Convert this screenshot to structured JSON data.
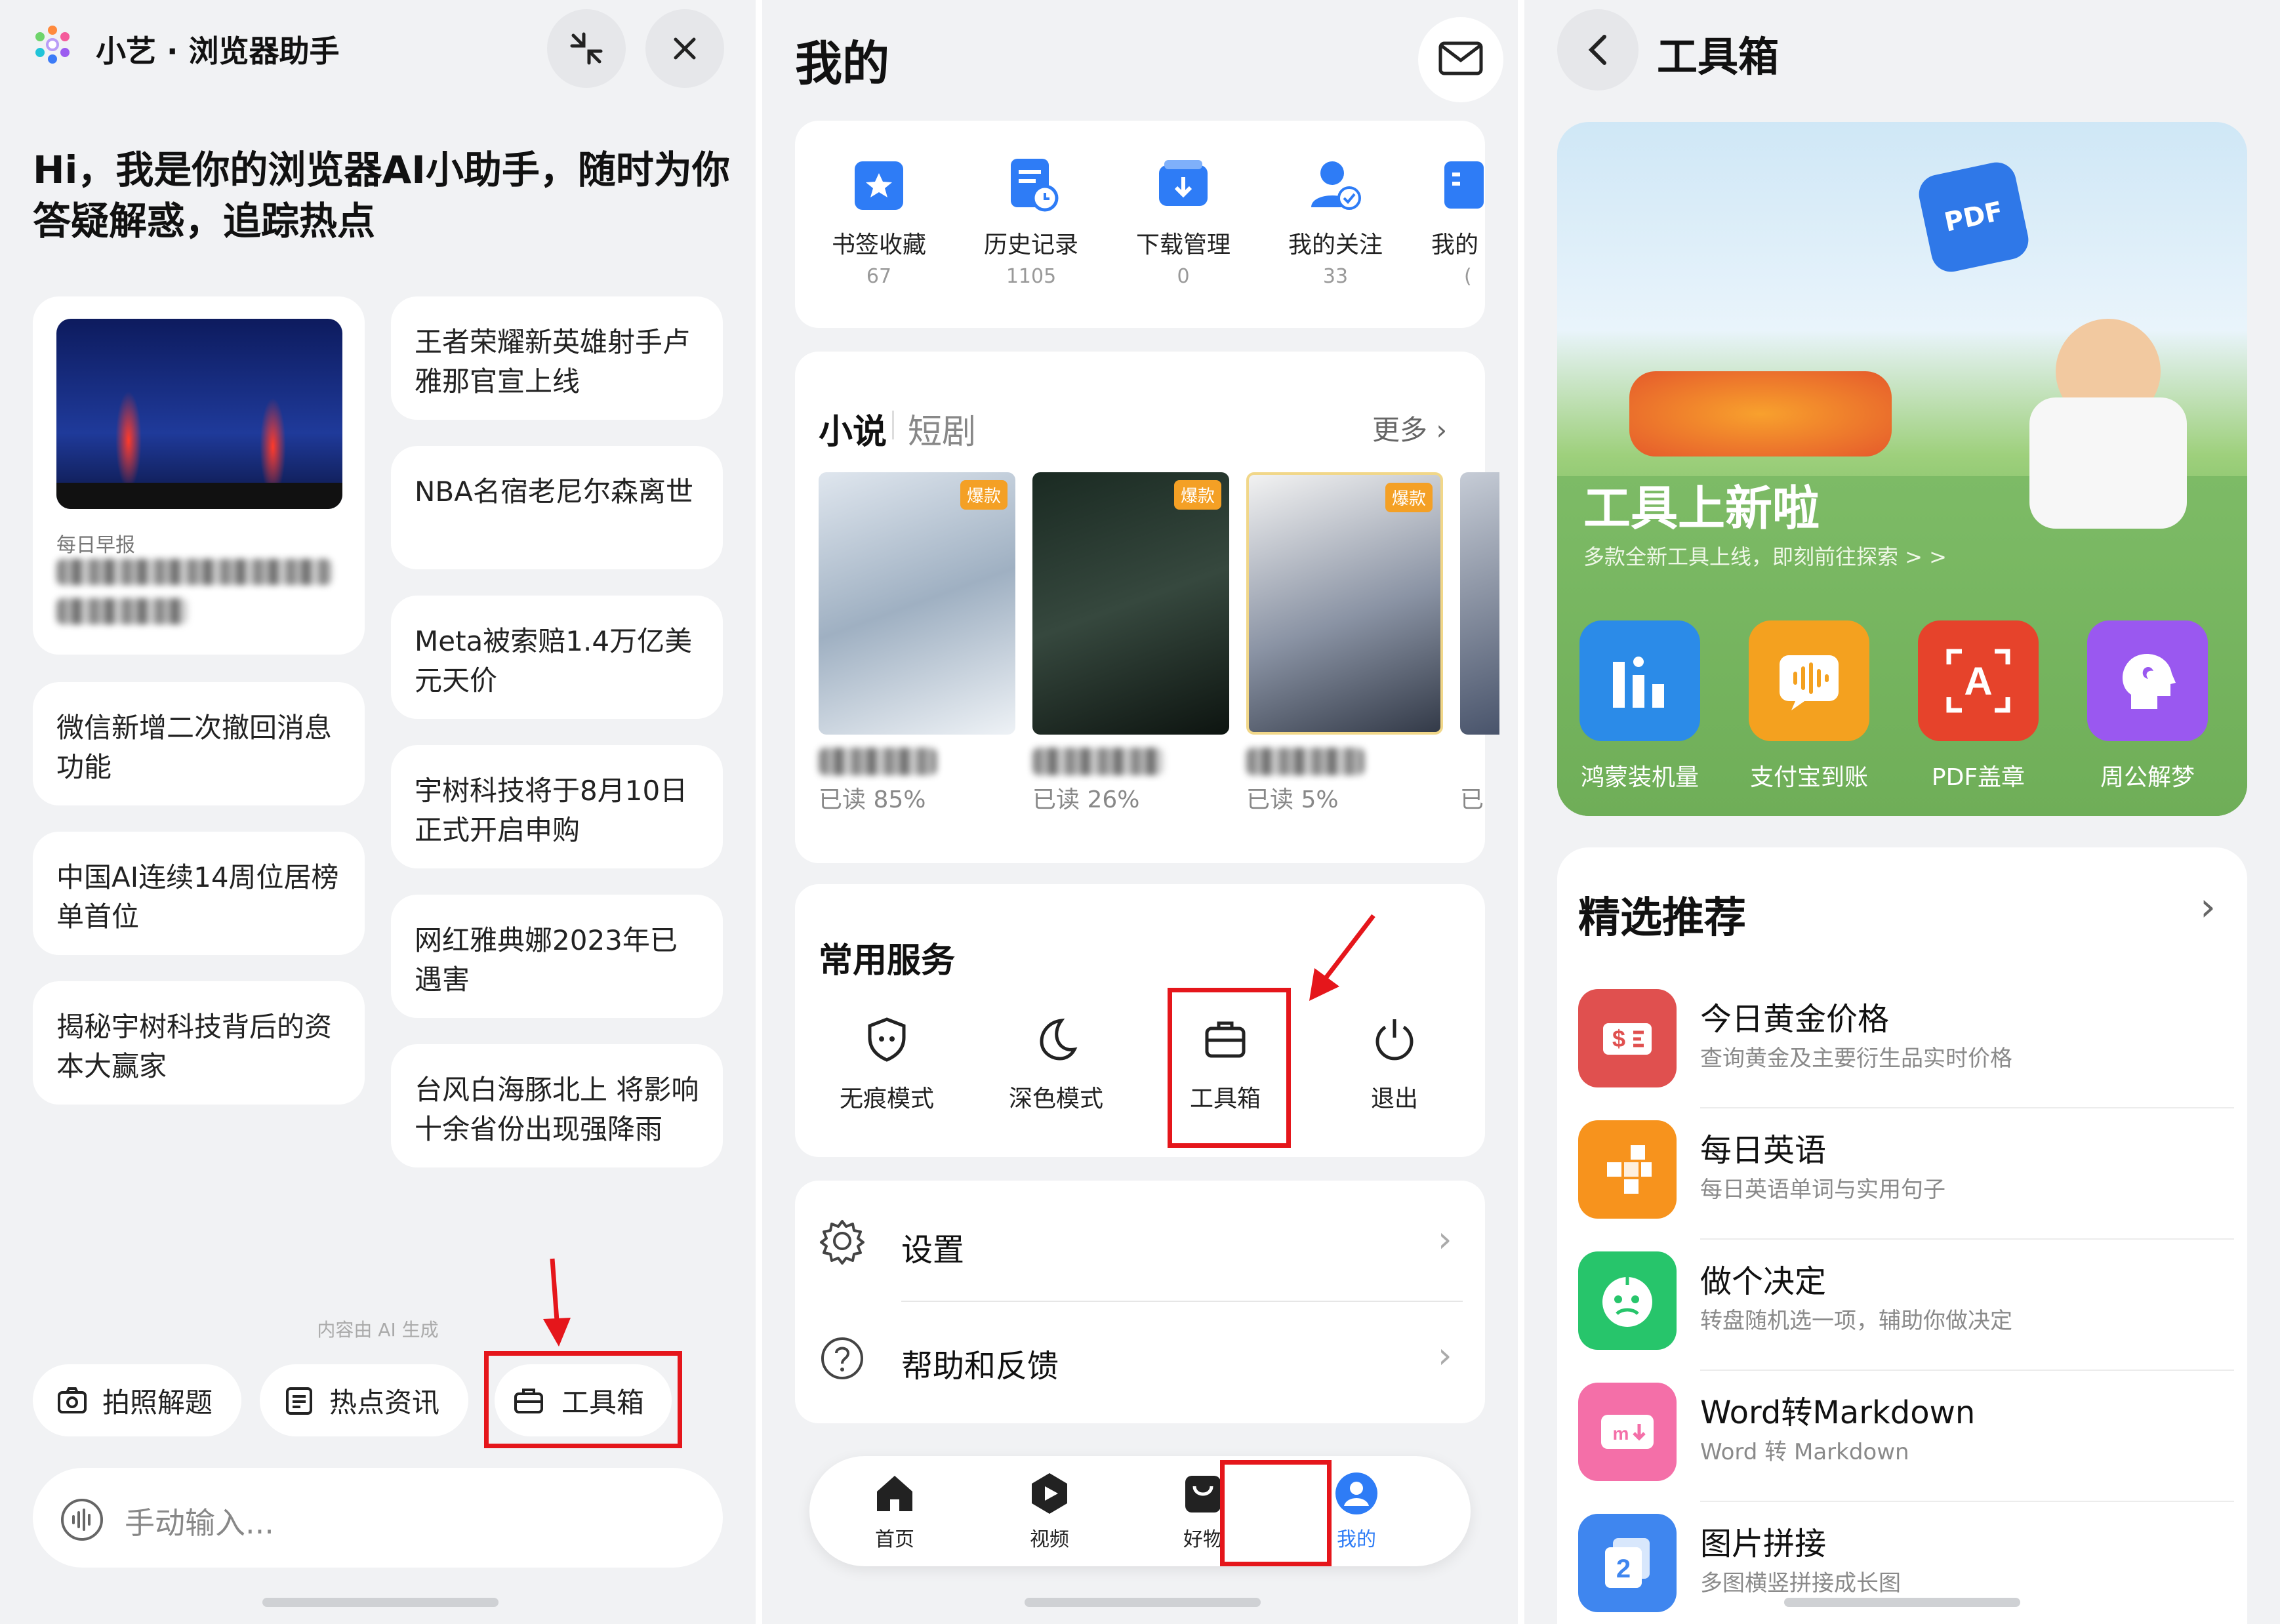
{
  "colors": {
    "accent_red": "#e5161b",
    "brand_blue": "#2e7cf6",
    "badge_orange": "#f4a025",
    "card_bg": "#ffffff",
    "panel_bg": "#f1f2f4"
  },
  "assistant": {
    "title": "小艺 · 浏览器助手",
    "greeting": "Hi，我是你的浏览器AI小助手，随时为你答疑解惑，追踪热点",
    "daily_label": "每日早报",
    "news_left": [
      "微信新增二次撤回消息功能",
      "中国AI连续14周位居榜单首位",
      "揭秘宇树科技背后的资本大赢家"
    ],
    "news_right": [
      "王者荣耀新英雄射手卢雅那官宣上线",
      "NBA名宿老尼尔森离世",
      "Meta被索赔1.4万亿美元天价",
      "宇树科技将于8月10日正式开启申购",
      "网红雅典娜2023年已遇害",
      "台风白海豚北上 将影响十余省份出现强降雨"
    ],
    "ai_note": "内容由 AI 生成",
    "actions": [
      "拍照解题",
      "热点资讯",
      "工具箱"
    ],
    "input_placeholder": "手动输入..."
  },
  "mine": {
    "title": "我的",
    "quick": [
      {
        "label": "书签收藏",
        "count": "67",
        "icon": "bookmark-icon"
      },
      {
        "label": "历史记录",
        "count": "1105",
        "icon": "history-icon"
      },
      {
        "label": "下载管理",
        "count": "0",
        "icon": "download-icon"
      },
      {
        "label": "我的关注",
        "count": "33",
        "icon": "follow-icon"
      },
      {
        "label": "我的",
        "count": "(",
        "icon": "more-icon"
      }
    ],
    "tabs": [
      "小说",
      "短剧"
    ],
    "more": "更多",
    "novels": [
      {
        "badge": "爆款",
        "read": "已读 85%"
      },
      {
        "badge": "爆款",
        "read": "已读 26%"
      },
      {
        "badge": "爆款",
        "read": "已读 5%"
      },
      {
        "read": "已"
      }
    ],
    "services_title": "常用服务",
    "services": [
      "无痕模式",
      "深色模式",
      "工具箱",
      "退出"
    ],
    "menu": [
      "设置",
      "帮助和反馈"
    ],
    "nav": [
      "首页",
      "视频",
      "好物",
      "我的"
    ]
  },
  "toolbox": {
    "title": "工具箱",
    "banner_title": "工具上新啦",
    "banner_sub": "多款全新工具上线，即刻前往探索 > >",
    "tools": [
      {
        "label": "鸿蒙装机量",
        "color": "#2b8be8",
        "icon": "chart-bars-icon"
      },
      {
        "label": "支付宝到账",
        "color": "#f4a11f",
        "icon": "voice-wave-icon"
      },
      {
        "label": "PDF盖章",
        "color": "#e6432b",
        "icon": "pdf-stamp-icon"
      },
      {
        "label": "周公解梦",
        "color": "#9a58f0",
        "icon": "dream-head-icon"
      }
    ],
    "rec_title": "精选推荐",
    "recs": [
      {
        "title": "今日黄金价格",
        "sub": "查询黄金及主要衍生品实时价格",
        "color": "#e0504f",
        "icon": "price-tag-icon"
      },
      {
        "title": "每日英语",
        "sub": "每日英语单词与实用句子",
        "color": "#f7931d",
        "icon": "blocks-icon"
      },
      {
        "title": "做个决定",
        "sub": "转盘随机选一项，辅助你做决定",
        "color": "#27c56b",
        "icon": "decision-face-icon"
      },
      {
        "title": "Word转Markdown",
        "sub": "Word 转 Markdown",
        "color": "#f46fa8",
        "icon": "markdown-icon"
      },
      {
        "title": "图片拼接",
        "sub": "多图横竖拼接成长图",
        "color": "#3f86ef",
        "icon": "image-stitch-icon"
      }
    ]
  }
}
